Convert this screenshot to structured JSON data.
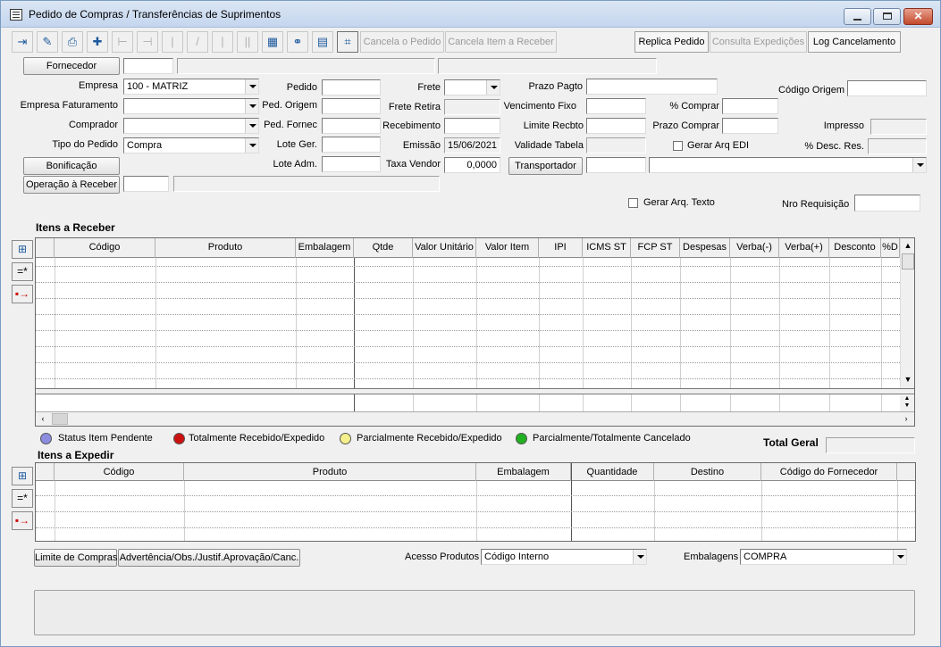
{
  "window": {
    "title": "Pedido de Compras / Transferências de Suprimentos"
  },
  "toolbar": {
    "cancela_pedido": "Cancela o Pedido",
    "cancela_item": "Cancela Item a Receber",
    "replica": "Replica Pedido",
    "consulta": "Consulta Expedições",
    "log": "Log Cancelamento"
  },
  "form": {
    "fornecedor_btn": "Fornecedor",
    "empresa_label": "Empresa",
    "empresa_value": "100 - MATRIZ",
    "empresa_fat_label": "Empresa Faturamento",
    "comprador_label": "Comprador",
    "tipo_label": "Tipo do Pedido",
    "tipo_value": "Compra",
    "bonificacao_btn": "Bonificação",
    "operacao_btn": "Operação à Receber",
    "pedido_label": "Pedido",
    "ped_origem_label": "Ped. Origem",
    "ped_fornec_label": "Ped. Fornec",
    "lote_ger_label": "Lote Ger.",
    "lote_adm_label": "Lote Adm.",
    "frete_label": "Frete",
    "frete_retira_label": "Frete Retira",
    "recebimento_label": "Recebimento",
    "emissao_label": "Emissão",
    "emissao_value": "15/06/2021",
    "taxa_label": "Taxa Vendor",
    "taxa_value": "0,0000",
    "prazo_pagto_label": "Prazo Pagto",
    "venc_fixo_label": "Vencimento Fixo",
    "limite_label": "Limite Recbto",
    "validade_label": "Validade Tabela",
    "transportador_btn": "Transportador",
    "comprar_pct_label": "% Comprar",
    "prazo_comprar_label": "Prazo Comprar",
    "gerar_edi_label": "Gerar Arq EDI",
    "codigo_origem_label": "Código Origem",
    "impresso_label": "Impresso",
    "desc_res_label": "% Desc. Res.",
    "gerar_texto_label": "Gerar Arq. Texto",
    "nro_req_label": "Nro Requisição"
  },
  "itens_receber": {
    "title": "Itens a Receber",
    "columns": [
      "Código",
      "Produto",
      "Embalagem",
      "Qtde",
      "Valor Unitário",
      "Valor Item",
      "IPI",
      "ICMS ST",
      "FCP ST",
      "Despesas",
      "Verba(-)",
      "Verba(+)",
      "Desconto",
      "%D"
    ]
  },
  "legend": {
    "pendente": "Status Item Pendente",
    "total": "Totalmente Recebido/Expedido",
    "parcial": "Parcialmente Recebido/Expedido",
    "cancelado": "Parcialmente/Totalmente Cancelado",
    "total_geral": "Total Geral"
  },
  "itens_expedir": {
    "title": "Itens a Expedir",
    "columns": [
      "Código",
      "Produto",
      "Embalagem",
      "Quantidade",
      "Destino",
      "Código do Fornecedor"
    ]
  },
  "footer": {
    "limite_btn": "Limite de Compras",
    "advertencia_btn": "Advertência/Obs./Justif.Aprovação/Canc.",
    "acesso_label": "Acesso Produtos",
    "acesso_value": "Código Interno",
    "embalagens_label": "Embalagens",
    "embalagens_value": "COMPRA"
  },
  "colors": {
    "pendente": "#8c8ce0",
    "total": "#cc1010",
    "parcial": "#f4f08c",
    "cancelado": "#20b020"
  },
  "icons": [
    "exit-icon",
    "edit-icon",
    "print-icon",
    "add-icon",
    "indent-icon",
    "outdent-icon",
    "calendar-grid-icon",
    "binoculars-icon",
    "document-icon",
    "grid-edit-icon"
  ]
}
